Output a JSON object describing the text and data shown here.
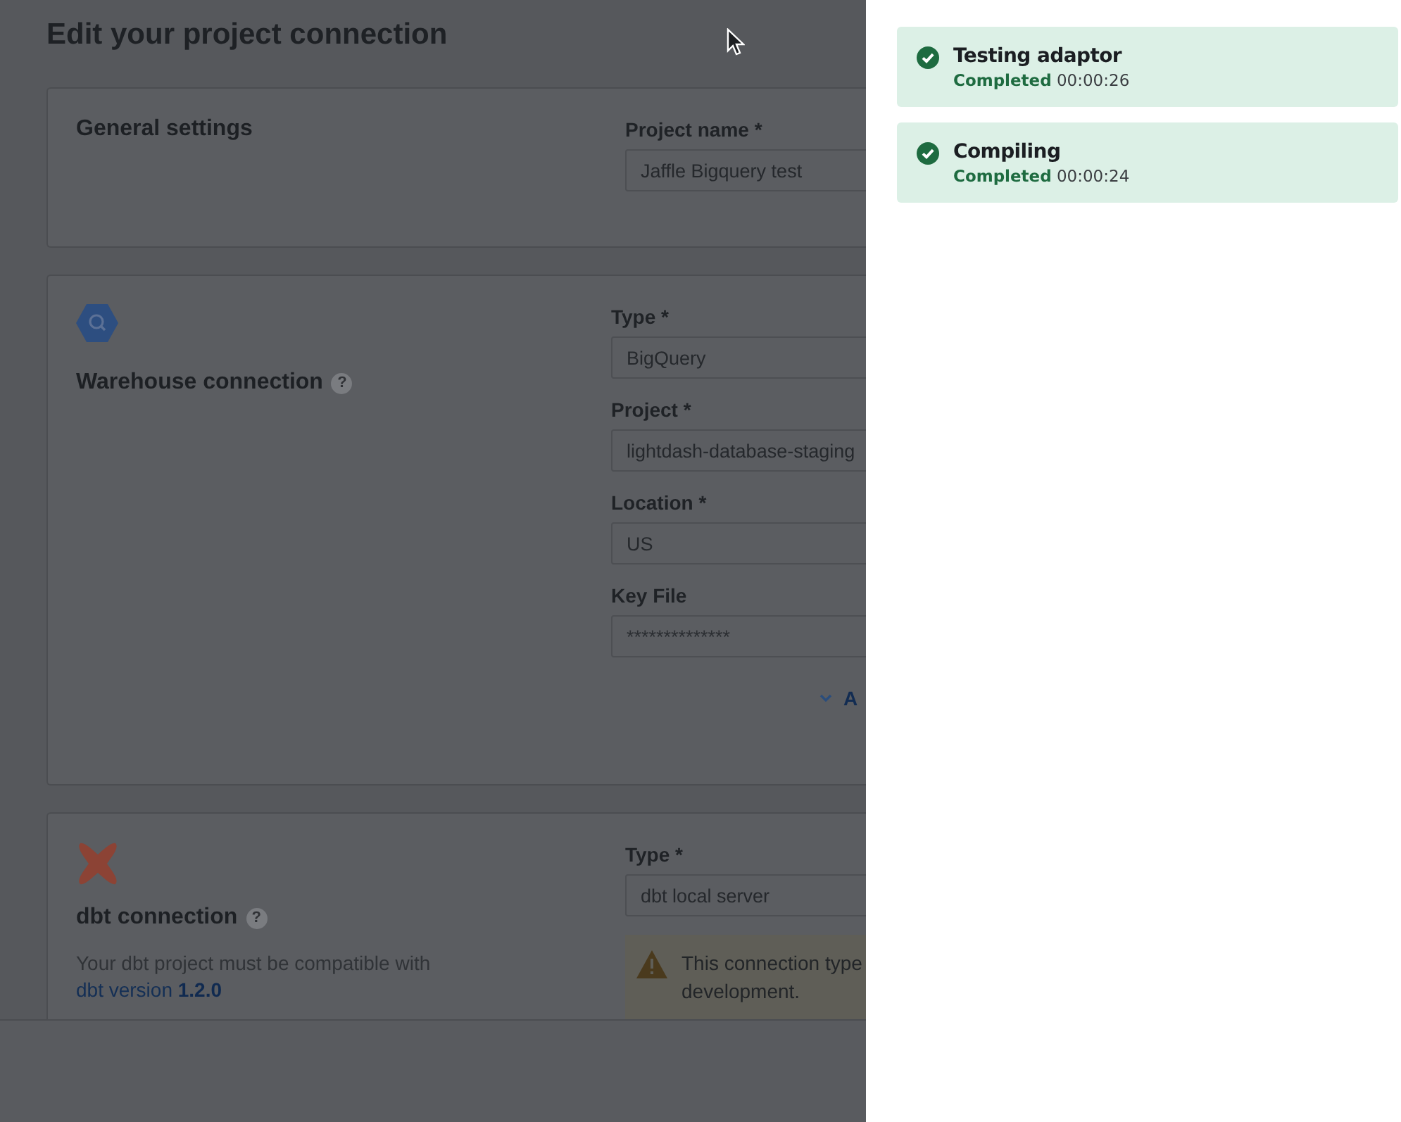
{
  "page": {
    "title": "Edit your project connection"
  },
  "sections": [
    {
      "kind": "general",
      "title": "General settings",
      "fields": [
        {
          "label": "Project name *",
          "value": "Jaffle Bigquery test"
        }
      ]
    },
    {
      "kind": "warehouse",
      "title": "Warehouse connection",
      "help": "?",
      "fields": [
        {
          "label": "Type *",
          "value": "BigQuery"
        },
        {
          "label": "Project *",
          "value": "lightdash-database-staging"
        },
        {
          "label": "Location *",
          "value": "US"
        },
        {
          "label": "Key File",
          "placeholder": "**************"
        }
      ],
      "link": "A"
    },
    {
      "kind": "dbt",
      "title": "dbt connection",
      "help": "?",
      "description": "Your dbt project must be compatible with ",
      "description_link": "dbt version 1.2.0",
      "fields": [
        {
          "label": "Type *",
          "value": "dbt local server"
        }
      ],
      "warning": [
        "This connection type",
        "development."
      ]
    }
  ],
  "toasts": [
    {
      "title": "Testing adaptor",
      "status": "Completed",
      "time": "00:00:26"
    },
    {
      "title": "Compiling",
      "status": "Completed",
      "time": "00:00:24"
    }
  ]
}
